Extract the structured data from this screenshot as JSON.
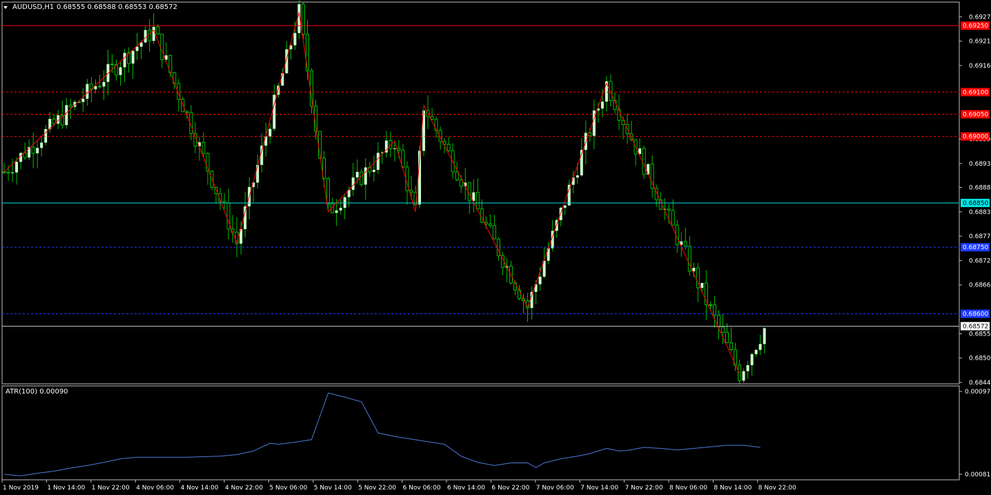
{
  "header": {
    "symbol": "AUDUSD,H1",
    "quote": "0.68555 0.68588 0.68553 0.68572"
  },
  "colors": {
    "background": "#000000",
    "frame": "#c0c0c0",
    "bull_candle": "#ccffcc",
    "wick": "#00c000",
    "zigzag": "#ff0000",
    "resistance": "#ff0000",
    "cyan_level": "#00e6e6",
    "blue_level": "#1e3cff",
    "atr_line": "#4e7ad8"
  },
  "chart_data": [
    {
      "type": "candlestick",
      "ylim": [
        0.68445,
        0.693
      ],
      "yticks": [
        "0.69270",
        "0.69215",
        "0.69160",
        "0.68994",
        "0.68939",
        "0.68885",
        "0.68830",
        "0.68775",
        "0.68720",
        "0.68665",
        "0.68555",
        "0.68500",
        "0.68445"
      ],
      "xticks": [
        "1 Nov 2019",
        "1 Nov 14:00",
        "1 Nov 22:00",
        "4 Nov 06:00",
        "4 Nov 14:00",
        "4 Nov 22:00",
        "5 Nov 06:00",
        "5 Nov 14:00",
        "5 Nov 22:00",
        "6 Nov 06:00",
        "6 Nov 14:00",
        "6 Nov 22:00",
        "7 Nov 06:00",
        "7 Nov 14:00",
        "7 Nov 22:00",
        "8 Nov 06:00",
        "8 Nov 14:00",
        "8 Nov 22:00"
      ],
      "levels": [
        {
          "price": 0.6925,
          "label": "0.69250",
          "style": "solid",
          "color": "#ff0000"
        },
        {
          "price": 0.691,
          "label": "0.69100",
          "style": "dashed",
          "color": "#ff0000"
        },
        {
          "price": 0.6905,
          "label": "0.69050",
          "style": "dashed",
          "color": "#ff0000"
        },
        {
          "price": 0.69,
          "label": "0.69000",
          "style": "dashed",
          "color": "#ff0000"
        },
        {
          "price": 0.6885,
          "label": "0.68850",
          "style": "solid",
          "color": "#00e6e6"
        },
        {
          "price": 0.6875,
          "label": "0.68750",
          "style": "dashed",
          "color": "#1e3cff"
        },
        {
          "price": 0.686,
          "label": "0.68600",
          "style": "dashed",
          "color": "#1e3cff"
        },
        {
          "price": 0.68572,
          "label": "0.68572",
          "style": "solid",
          "color": "#c0c0c0"
        }
      ],
      "zigzag": [
        {
          "bar": 0,
          "price": 0.6892
        },
        {
          "bar": 36,
          "price": 0.6924
        },
        {
          "bar": 56,
          "price": 0.6876
        },
        {
          "bar": 71,
          "price": 0.6928
        },
        {
          "bar": 78,
          "price": 0.6883
        },
        {
          "bar": 94,
          "price": 0.6899
        },
        {
          "bar": 99,
          "price": 0.6883
        },
        {
          "bar": 101,
          "price": 0.6907
        },
        {
          "bar": 126,
          "price": 0.68615
        },
        {
          "bar": 145,
          "price": 0.6912
        },
        {
          "bar": 177,
          "price": 0.68465
        }
      ]
    },
    {
      "type": "line",
      "title": "ATR(100) 0.00090",
      "ylim": [
        0.00081,
        0.00097
      ],
      "yticks": [
        "0.00097",
        "0.00081"
      ],
      "series": [
        {
          "name": "ATR(100)",
          "points": [
            [
              0,
              0.00081
            ],
            [
              4,
              0.000807
            ],
            [
              8,
              0.000812
            ],
            [
              12,
              0.000816
            ],
            [
              16,
              0.000822
            ],
            [
              20,
              0.000827
            ],
            [
              24,
              0.000833
            ],
            [
              28,
              0.00084
            ],
            [
              32,
              0.000843
            ],
            [
              36,
              0.000843
            ],
            [
              40,
              0.000843
            ],
            [
              44,
              0.000843
            ],
            [
              48,
              0.000844
            ],
            [
              52,
              0.000845
            ],
            [
              56,
              0.000848
            ],
            [
              60,
              0.000855
            ],
            [
              64,
              0.00087
            ],
            [
              66,
              0.000868
            ],
            [
              70,
              0.000872
            ],
            [
              74,
              0.000877
            ],
            [
              78,
              0.000967
            ],
            [
              82,
              0.000959
            ],
            [
              86,
              0.00095
            ],
            [
              90,
              0.00089
            ],
            [
              94,
              0.000883
            ],
            [
              98,
              0.000878
            ],
            [
              102,
              0.000873
            ],
            [
              106,
              0.000868
            ],
            [
              110,
              0.000845
            ],
            [
              114,
              0.000833
            ],
            [
              118,
              0.000827
            ],
            [
              122,
              0.000832
            ],
            [
              126,
              0.000832
            ],
            [
              128,
              0.000823
            ],
            [
              130,
              0.000832
            ],
            [
              134,
              0.00084
            ],
            [
              138,
              0.000845
            ],
            [
              141,
              0.00085
            ],
            [
              145,
              0.00086
            ],
            [
              148,
              0.000855
            ],
            [
              150,
              0.000856
            ],
            [
              154,
              0.000862
            ],
            [
              158,
              0.00086
            ],
            [
              162,
              0.000857
            ],
            [
              166,
              0.00086
            ],
            [
              170,
              0.000863
            ],
            [
              174,
              0.000866
            ],
            [
              178,
              0.000866
            ],
            [
              182,
              0.000862
            ]
          ]
        }
      ]
    }
  ]
}
